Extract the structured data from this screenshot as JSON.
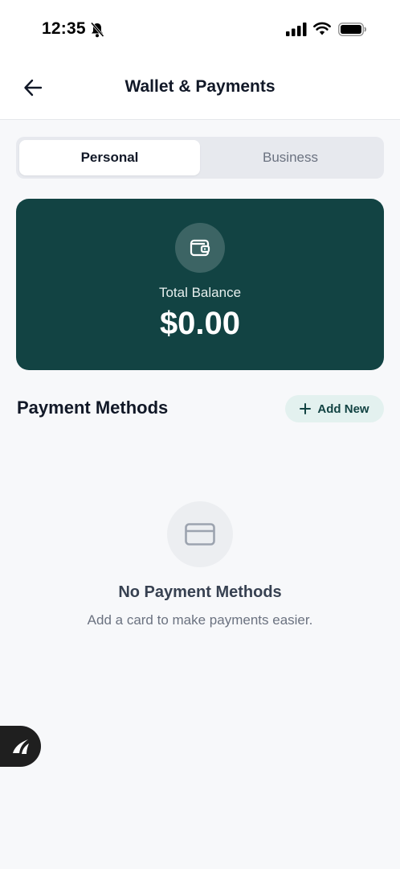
{
  "status_bar": {
    "time": "12:35",
    "icons": [
      "bell-slash-icon",
      "cellular-signal-icon",
      "wifi-icon",
      "battery-icon"
    ]
  },
  "header": {
    "title": "Wallet & Payments",
    "back_icon": "arrow-left-icon"
  },
  "segmented": {
    "tabs": [
      {
        "label": "Personal",
        "active": true
      },
      {
        "label": "Business",
        "active": false
      }
    ]
  },
  "balance_card": {
    "icon": "wallet-icon",
    "label": "Total Balance",
    "amount": "$0.00"
  },
  "payment_methods": {
    "title": "Payment Methods",
    "add_button_label": "Add New",
    "add_icon": "plus-icon"
  },
  "empty_state": {
    "icon": "credit-card-icon",
    "title": "No Payment Methods",
    "subtitle": "Add a card to make payments easier."
  },
  "floating_badge": {
    "icon": "app-logo-icon"
  },
  "colors": {
    "brand": "#124343",
    "accent_light": "#e3f1ef",
    "background": "#f7f8fa"
  }
}
